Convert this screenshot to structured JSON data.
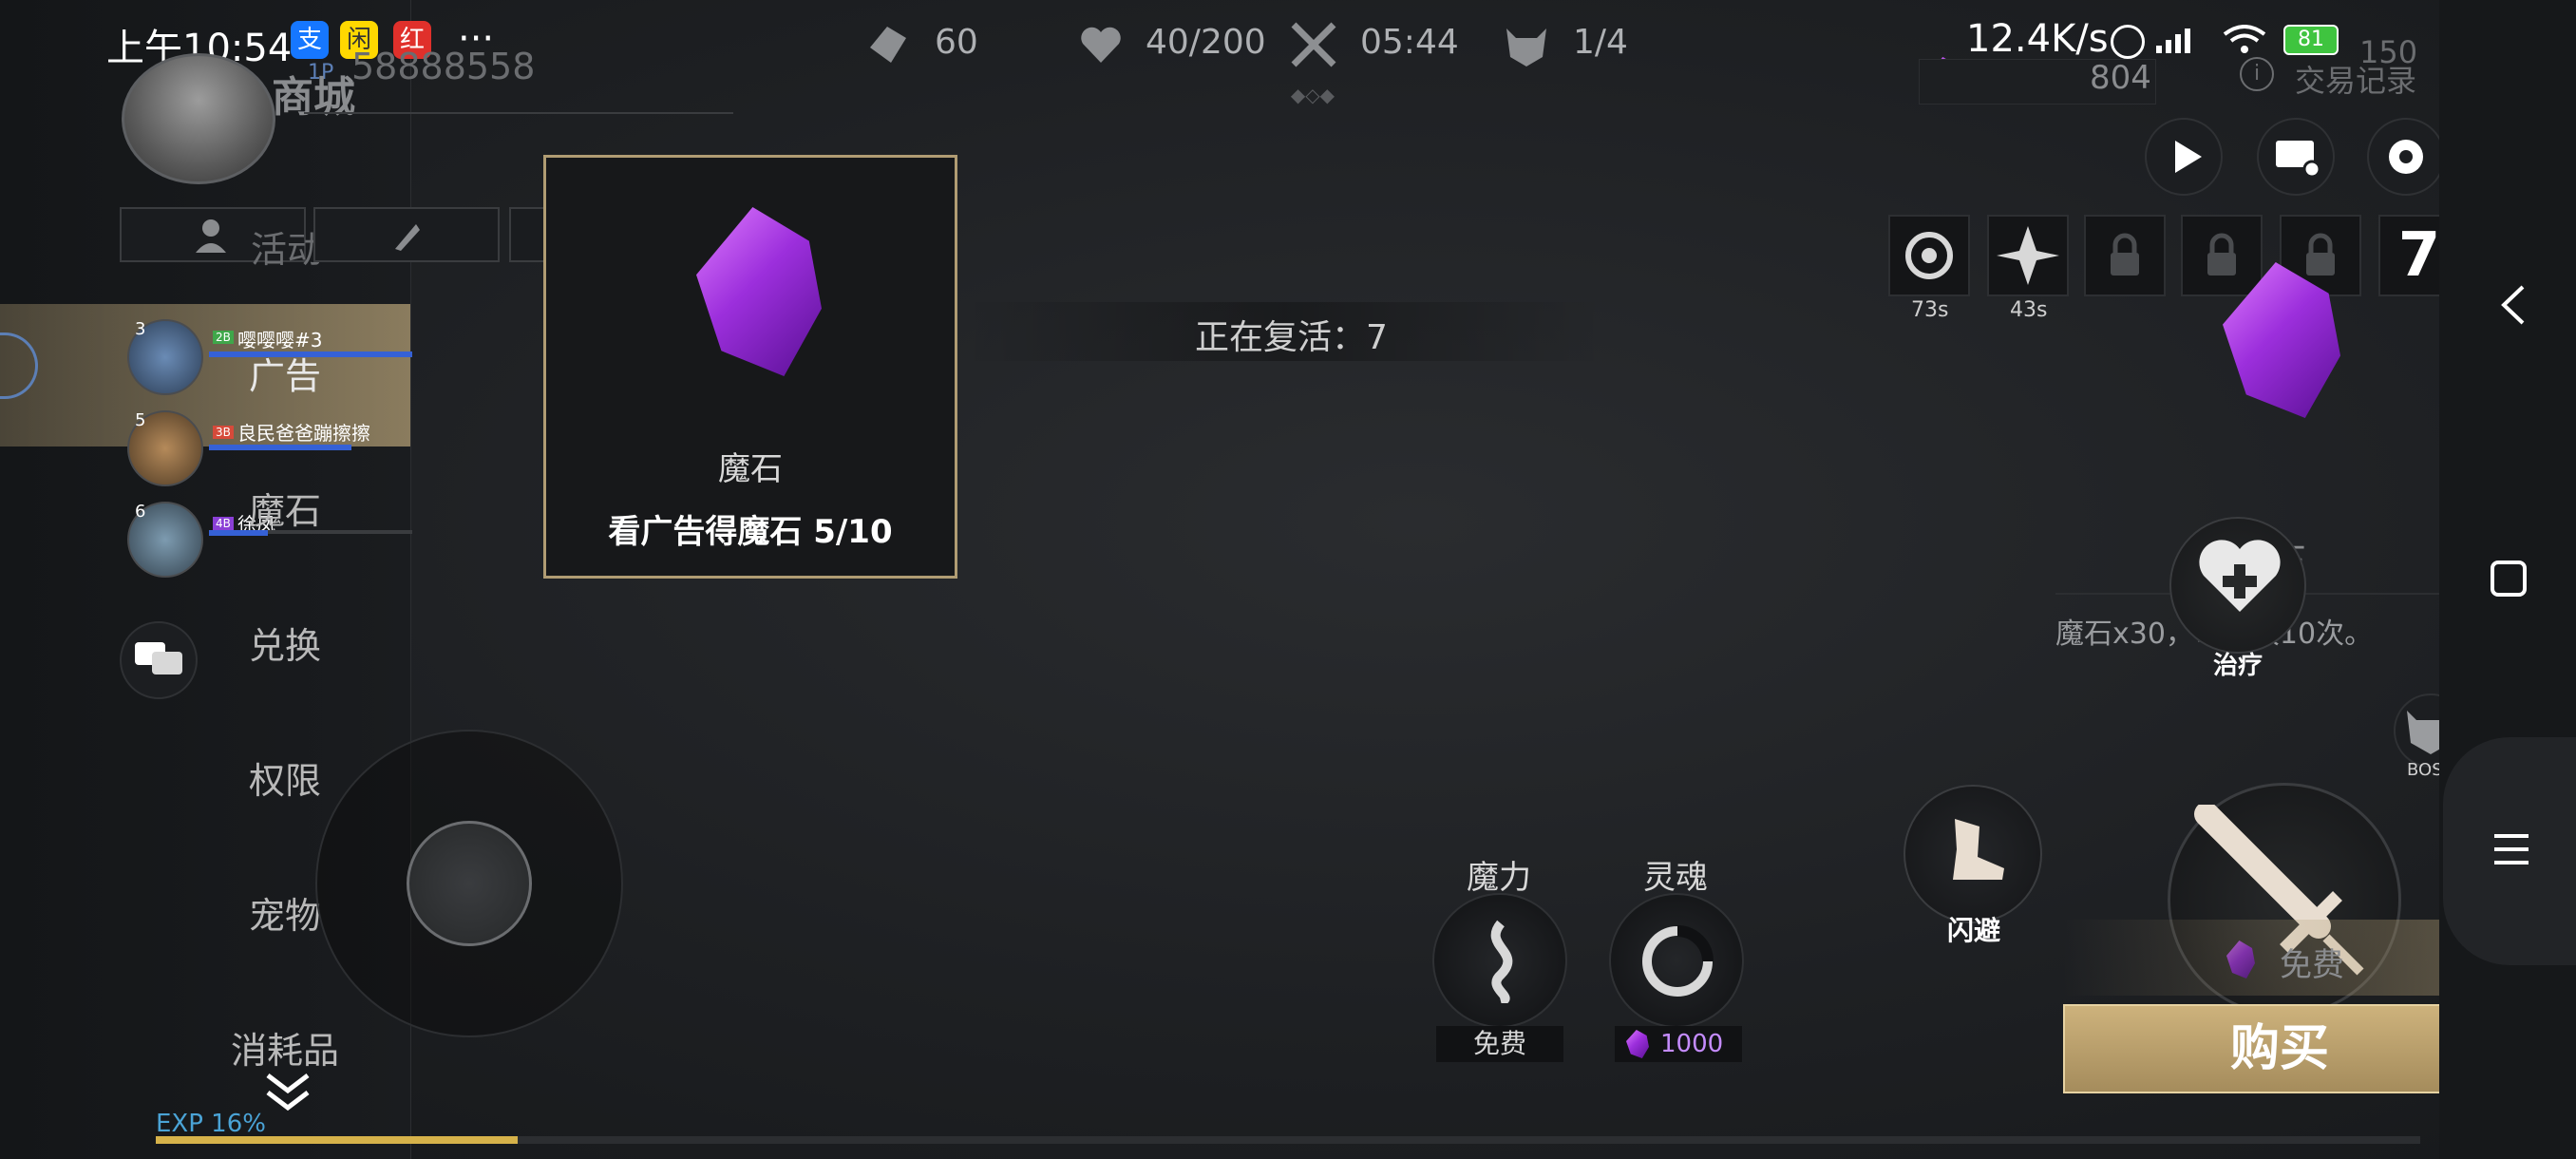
{
  "status_bar": {
    "time": "上午10:54",
    "more": "···",
    "network_speed": "12.4K/s",
    "battery": "81",
    "apps": [
      "支",
      "闲",
      "红"
    ]
  },
  "top_resources": {
    "stamina": "60",
    "health": "40/200",
    "timer": "05:44",
    "waves": "1/4",
    "gems_bg": "150",
    "gems_count": "804",
    "trade_record": "交易记录"
  },
  "profile": {
    "uid_prefix": "1P",
    "uid": "58888558",
    "shop_title": "商城"
  },
  "left_tabs": {
    "activity": "活动"
  },
  "left_menu": [
    "广告",
    "魔石",
    "兑换",
    "权限",
    "宠物",
    "消耗品"
  ],
  "party": [
    {
      "level": "3",
      "badge": "2B",
      "name": "嘤嘤嘤#3"
    },
    {
      "level": "5",
      "badge": "3B",
      "name": "良民爸爸蹦擦擦"
    },
    {
      "level": "6",
      "badge": "4B",
      "name": "徐凤"
    }
  ],
  "ad_card": {
    "title": "魔石",
    "subtitle": "看广告得魔石 5/10"
  },
  "reviving": "正在复活：7",
  "skill_slots": {
    "slot1_timer": "73s",
    "slot2_timer": "43s",
    "counter": "7"
  },
  "detail": {
    "title": "魔石",
    "desc": "魔石x30，每日限10次。",
    "heal_label": "治疗",
    "boss_label": "BOSS",
    "dodge_label": "闪避",
    "free_label": "免费",
    "attack_label": "攻击",
    "buy_label": "购买"
  },
  "spells": {
    "mana_title": "魔力",
    "mana_cost": "免费",
    "soul_title": "灵魂",
    "soul_cost": "1000"
  },
  "exp": {
    "label": "EXP 16%",
    "percent": 16
  },
  "colors": {
    "accent_gold": "#b09c73",
    "gem_purple": "#9c2fdc",
    "exp_bar": "#d6b24a",
    "exp_text": "#4aa3d6",
    "health_blue": "#3561d6"
  }
}
